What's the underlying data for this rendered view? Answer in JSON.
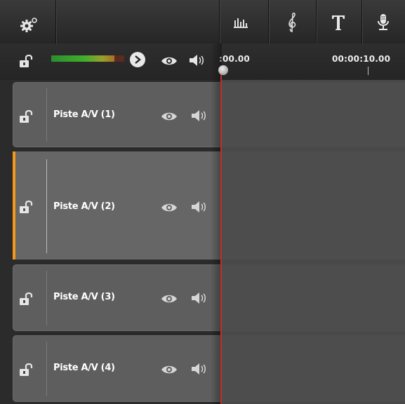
{
  "toolbar": {
    "icons": [
      "gear-icon",
      "audio-mixer-icon",
      "treble-clef-icon",
      "title-text-icon",
      "microphone-icon"
    ]
  },
  "control_row": {
    "timecode_start": ":00.00",
    "timecode_10s": "00:00:10.00",
    "meter_colors": [
      "#2d8e2d",
      "#9aa02b",
      "#b04a1f"
    ]
  },
  "tracks": [
    {
      "label": "Piste A/V (1)",
      "selected": false
    },
    {
      "label": "Piste A/V (2)",
      "selected": true
    },
    {
      "label": "Piste A/V (3)",
      "selected": false
    },
    {
      "label": "Piste A/V (4)",
      "selected": false
    }
  ],
  "colors": {
    "selection_accent": "#f39a1c",
    "playhead": "#c42c2c"
  }
}
